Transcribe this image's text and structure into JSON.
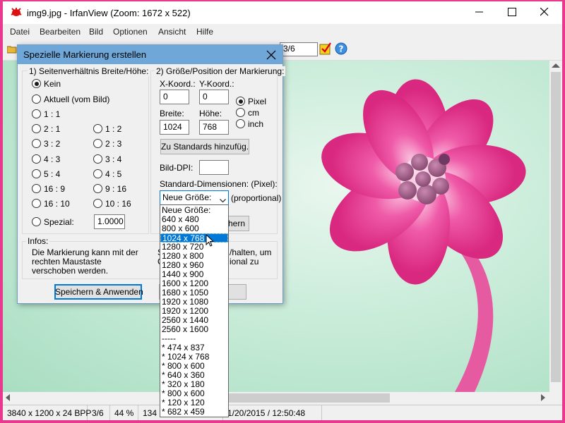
{
  "window": {
    "title": "img9.jpg - IrfanView (Zoom: 1672 x 522)"
  },
  "menu": [
    "Datei",
    "Bearbeiten",
    "Bild",
    "Optionen",
    "Ansicht",
    "Hilfe"
  ],
  "toolbar": {
    "page": "3/6"
  },
  "status": {
    "dimensions": "3840 x 1200 x 24 BPP",
    "page": "3/6",
    "zoom": "44 %",
    "coords": "134",
    "datetime": "1/20/2015 / 12:50:48"
  },
  "dialog": {
    "title": "Spezielle Markierung erstellen",
    "group1_label": "1) Seitenverhältnis Breite/Höhe:",
    "group2_label": "2) Größe/Position der Markierung:",
    "ratios_left": [
      {
        "label": "Kein",
        "checked": true
      },
      {
        "label": "Aktuell (vom Bild)",
        "checked": false
      },
      {
        "label": "1 : 1",
        "checked": false
      },
      {
        "label": "2 : 1",
        "checked": false
      },
      {
        "label": "3 : 2",
        "checked": false
      },
      {
        "label": "4 : 3",
        "checked": false
      },
      {
        "label": "5 : 4",
        "checked": false
      },
      {
        "label": "16 : 9",
        "checked": false
      },
      {
        "label": "16 : 10",
        "checked": false
      }
    ],
    "ratios_right": [
      "1 : 2",
      "2 : 3",
      "3 : 4",
      "4 : 5",
      "9 : 16",
      "10 : 16"
    ],
    "special_label": "Spezial:",
    "special_value": "1.0000",
    "x_label": "X-Koord.:",
    "y_label": "Y-Koord.:",
    "x_value": "0",
    "y_value": "0",
    "width_label": "Breite:",
    "height_label": "Höhe:",
    "width_value": "1024",
    "height_value": "768",
    "units": [
      {
        "label": "Pixel",
        "checked": true
      },
      {
        "label": "cm",
        "checked": false
      },
      {
        "label": "inch",
        "checked": false
      }
    ],
    "add_defaults_button": "Zu Standards hinzufüg.",
    "dpi_label": "Bild-DPI:",
    "dpi_value": "",
    "std_dims_label": "Standard-Dimensionen: (Pixel):",
    "combo_value": "Neue Größe:",
    "proportional_label": "(proportional)",
    "partial_button": "chern",
    "infos_label": "Infos:",
    "info_left": "Die Markierung kann mit der rechten Maustaste verschoben werden.",
    "info_right_lines": [
      "S",
      "C",
      ""
    ],
    "info_right_frag1": "/halten, um",
    "info_right_frag2": "ional zu",
    "apply_button": "Speichern & Anwenden"
  },
  "dropdown": {
    "items": [
      "Neue Größe:",
      "640 x 480",
      "800 x 600",
      "1024 x 768",
      "1280 x 720",
      "1280 x 800",
      "1280 x 960",
      "1440 x 900",
      "1600 x 1200",
      "1680 x 1050",
      "1920 x 1080",
      "1920 x 1200",
      "2560 x 1440",
      "2560 x 1600",
      "-----",
      "* 474 x 837",
      "* 1024 x 768",
      "* 800 x 600",
      "* 640 x 360",
      "* 320 x 180",
      "* 800 x 600",
      "* 120 x 120",
      "* 682 x 459"
    ],
    "selected_index": 3
  },
  "colors": {
    "accent": "#0078d7",
    "dialog_title": "#6fa7d8",
    "frame": "#e8398f",
    "flower": "#e0358a"
  }
}
